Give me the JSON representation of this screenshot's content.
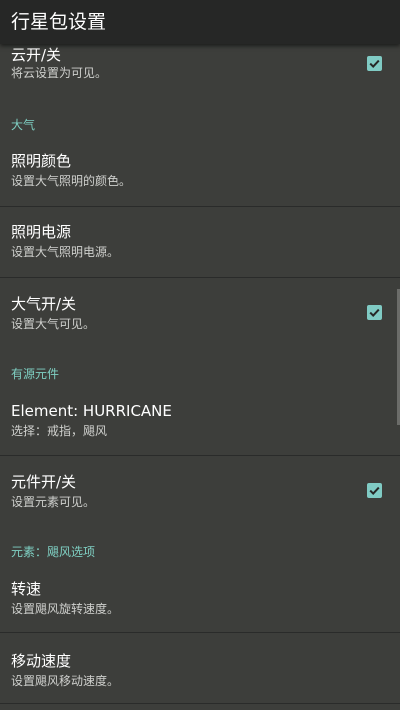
{
  "app_bar": {
    "title": "行星包设置"
  },
  "settings": {
    "cloud_toggle": {
      "title": "云开/关",
      "summary": "将云设置为可见。",
      "checked": true
    },
    "atmosphere_category": {
      "title": "大气"
    },
    "lighting_color": {
      "title": "照明颜色",
      "summary": "设置大气照明的颜色。"
    },
    "lighting_source": {
      "title": "照明电源",
      "summary": "设置大气照明电源。"
    },
    "atmosphere_toggle": {
      "title": "大气开/关",
      "summary": "设置大气可见。",
      "checked": true
    },
    "active_elements_category": {
      "title": "有源元件"
    },
    "element_hurricane": {
      "title": "Element: HURRICANE",
      "summary": "选择：戒指，飓风"
    },
    "element_toggle": {
      "title": "元件开/关",
      "summary": "设置元素可见。",
      "checked": true
    },
    "hurricane_options_category": {
      "title": "元素：飓风选项"
    },
    "rotation_speed": {
      "title": "转速",
      "summary": "设置飓风旋转速度。"
    },
    "move_speed": {
      "title": "移动速度",
      "summary": "设置飓风移动速度。"
    }
  },
  "colors": {
    "background": "#3d3e3b",
    "app_bar": "#262726",
    "accent": "#80cbc4",
    "divider": "#2a2b2a"
  }
}
